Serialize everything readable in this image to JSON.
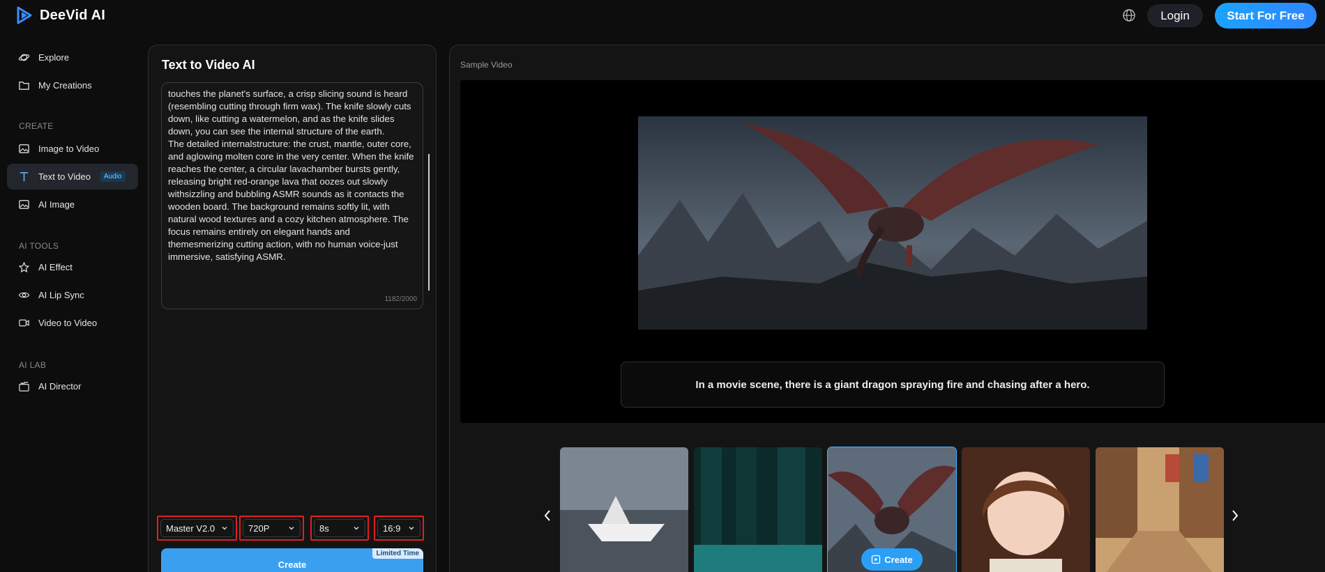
{
  "brand": {
    "name": "DeeVid AI",
    "accent": "#2f86ff"
  },
  "header": {
    "login_label": "Login",
    "start_label": "Start For Free",
    "globe_icon": "globe-icon"
  },
  "sidebar": {
    "top_items": [
      {
        "label": "Explore",
        "icon": "planet-icon"
      },
      {
        "label": "My Creations",
        "icon": "folder-icon"
      }
    ],
    "create_section": "CREATE",
    "create_items": [
      {
        "label": "Image to Video",
        "icon": "image-icon"
      },
      {
        "label": "Text to Video",
        "icon": "text-icon",
        "badge": "Audio",
        "active": true
      },
      {
        "label": "AI Image",
        "icon": "image-icon"
      }
    ],
    "tools_section": "AI TOOLS",
    "tools_items": [
      {
        "label": "AI Effect",
        "icon": "star-icon"
      },
      {
        "label": "AI Lip Sync",
        "icon": "eye-icon"
      },
      {
        "label": "Video to Video",
        "icon": "video-icon"
      }
    ],
    "lab_section": "AI LAB",
    "lab_items": [
      {
        "label": "AI Director",
        "icon": "clapper-icon"
      }
    ]
  },
  "left_panel": {
    "title": "Text to Video AI",
    "prompt": "touches the planet's surface, a crisp slicing sound is heard (resembling cutting through firm wax). The knife slowly cuts down, like cutting a watermelon, and as the knife slides down, you can see the internal structure of the earth.\nThe detailed internalstructure: the crust, mantle, outer core, and aglowing molten core in the very center. When the knife reaches the center, a circular lavachamber bursts gently, releasing bright red-orange lava that oozes out slowly withsizzling and bubbling ASMR sounds as it contacts the wooden board. The background remains softly lit, with natural wood textures and a cozy kitchen atmosphere. The focus remains entirely on elegant hands and themesmerizing cutting action, with no human voice-just immersive, satisfying ASMR.",
    "char_count": "1182/2000",
    "options": {
      "model": "Master V2.0",
      "resolution": "720P",
      "duration": "8s",
      "ratio": "16:9"
    },
    "create_label": "Create",
    "limited_label": "Limited Time"
  },
  "right_panel": {
    "sample_label": "Sample Video",
    "caption": "In a movie scene, there is a giant dragon spraying fire and chasing after a hero.",
    "thumbnails": [
      {
        "name": "paper-boat",
        "selected": false
      },
      {
        "name": "server-room",
        "selected": false
      },
      {
        "name": "dragon",
        "selected": true,
        "create_label": "Create"
      },
      {
        "name": "anime-girl",
        "selected": false
      },
      {
        "name": "market-street",
        "selected": false
      }
    ]
  }
}
